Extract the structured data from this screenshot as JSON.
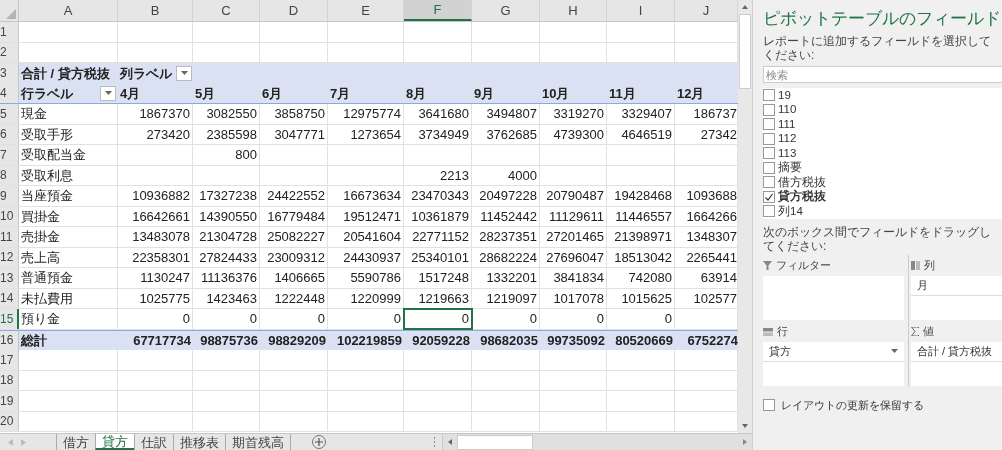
{
  "columns": [
    {
      "label": "A",
      "selected": false
    },
    {
      "label": "B",
      "selected": false
    },
    {
      "label": "C",
      "selected": false
    },
    {
      "label": "D",
      "selected": false
    },
    {
      "label": "E",
      "selected": false
    },
    {
      "label": "F",
      "selected": true
    },
    {
      "label": "G",
      "selected": false
    },
    {
      "label": "H",
      "selected": false
    },
    {
      "label": "I",
      "selected": false
    },
    {
      "label": "J",
      "selected": false
    }
  ],
  "rows": [
    {
      "number": "1",
      "selected": false,
      "kind": "empty"
    },
    {
      "number": "2",
      "selected": false,
      "kind": "empty"
    },
    {
      "number": "3",
      "selected": false,
      "kind": "pivot_header",
      "value_field": "合計 / 貸方税抜",
      "column_label": "列ラベル"
    },
    {
      "number": "4",
      "selected": false,
      "kind": "column_labels",
      "row_label": "行ラベル",
      "months": [
        "4月",
        "5月",
        "6月",
        "7月",
        "8月",
        "9月",
        "10月",
        "11月",
        "12月"
      ]
    },
    {
      "number": "5",
      "selected": false,
      "kind": "data",
      "label": "現金",
      "values": [
        "1867370",
        "3082550",
        "3858750",
        "12975774",
        "3641680",
        "3494807",
        "3319270",
        "3329407",
        "186737"
      ]
    },
    {
      "number": "6",
      "selected": false,
      "kind": "data",
      "label": "受取手形",
      "values": [
        "273420",
        "2385598",
        "3047771",
        "1273654",
        "3734949",
        "3762685",
        "4739300",
        "4646519",
        "27342"
      ]
    },
    {
      "number": "7",
      "selected": false,
      "kind": "data",
      "label": "受取配当金",
      "values": [
        {
          "kind": "blank"
        },
        "800",
        {
          "kind": "blank"
        },
        {
          "kind": "blank"
        },
        {
          "kind": "blank"
        },
        {
          "kind": "blank"
        },
        {
          "kind": "blank"
        },
        {
          "kind": "blank"
        },
        {
          "kind": "blank"
        }
      ]
    },
    {
      "number": "8",
      "selected": false,
      "kind": "data",
      "label": "受取利息",
      "values": [
        {
          "kind": "blank"
        },
        {
          "kind": "blank"
        },
        {
          "kind": "blank"
        },
        {
          "kind": "blank"
        },
        "2213",
        "4000",
        {
          "kind": "blank"
        },
        {
          "kind": "blank"
        },
        {
          "kind": "blank"
        }
      ]
    },
    {
      "number": "9",
      "selected": false,
      "kind": "data",
      "label": "当座預金",
      "values": [
        "10936882",
        "17327238",
        "24422552",
        "16673634",
        "23470343",
        "20497228",
        "20790487",
        "19428468",
        "1093688"
      ]
    },
    {
      "number": "10",
      "selected": false,
      "kind": "data",
      "label": "買掛金",
      "values": [
        "16642661",
        "14390550",
        "16779484",
        "19512471",
        "10361879",
        "11452442",
        "11129611",
        "11446557",
        "1664266"
      ]
    },
    {
      "number": "11",
      "selected": false,
      "kind": "data",
      "label": "売掛金",
      "values": [
        "13483078",
        "21304728",
        "25082227",
        "20541604",
        "22771152",
        "28237351",
        "27201465",
        "21398971",
        "1348307"
      ]
    },
    {
      "number": "12",
      "selected": false,
      "kind": "data",
      "label": "売上高",
      "values": [
        "22358301",
        "27824433",
        "23009312",
        "24430937",
        "25340101",
        "28682224",
        "27696047",
        "18513042",
        "2265441"
      ]
    },
    {
      "number": "13",
      "selected": false,
      "kind": "data",
      "label": "普通預金",
      "values": [
        "1130247",
        "11136376",
        "1406665",
        "5590786",
        "1517248",
        "1332201",
        "3841834",
        "742080",
        "63914"
      ]
    },
    {
      "number": "14",
      "selected": false,
      "kind": "data",
      "label": "未払費用",
      "values": [
        "1025775",
        "1423463",
        "1222448",
        "1220999",
        "1219663",
        "1219097",
        "1017078",
        "1015625",
        "102577"
      ]
    },
    {
      "number": "15",
      "selected": true,
      "kind": "data",
      "label": "預り金",
      "values": [
        "0",
        "0",
        "0",
        "0",
        "0",
        "0",
        "0",
        "0",
        {
          "kind": "blank"
        }
      ]
    },
    {
      "number": "16",
      "selected": false,
      "kind": "total",
      "label": "総計",
      "values": [
        "67717734",
        "98875736",
        "98829209",
        "102219859",
        "92059228",
        "98682035",
        "99735092",
        "80520669",
        "6752274"
      ]
    },
    {
      "number": "17",
      "selected": false,
      "kind": "empty"
    },
    {
      "number": "18",
      "selected": false,
      "kind": "empty"
    },
    {
      "number": "19",
      "selected": false,
      "kind": "empty"
    },
    {
      "number": "20",
      "selected": false,
      "kind": "empty"
    }
  ],
  "sheet_tabs": [
    {
      "label": "借方",
      "selected": false
    },
    {
      "label": "貸方",
      "selected": true
    },
    {
      "label": "仕訳",
      "selected": false
    },
    {
      "label": "推移表",
      "selected": false
    },
    {
      "label": "期首残高",
      "selected": false
    }
  ],
  "pivot_panel": {
    "title": "ピボットテーブルのフィールド",
    "subtitle": "レポートに追加するフィールドを選択してください:",
    "search": {
      "placeholder": "検索"
    },
    "fields": [
      {
        "label": "19",
        "checked": false
      },
      {
        "label": "110",
        "checked": false
      },
      {
        "label": "111",
        "checked": false
      },
      {
        "label": "112",
        "checked": false
      },
      {
        "label": "113",
        "checked": false
      },
      {
        "label": "摘要",
        "checked": false
      },
      {
        "label": "借方税抜",
        "checked": false
      },
      {
        "label": "貸方税抜",
        "checked": true
      },
      {
        "label": "列14",
        "checked": false
      }
    ],
    "drag_hint": "次のボックス間でフィールドをドラッグしてください:",
    "areas": [
      {
        "kind": "filter",
        "title": "フィルター"
      },
      {
        "kind": "columns",
        "title": "列",
        "items": [
          {
            "label": "月"
          }
        ]
      },
      {
        "kind": "rows",
        "title": "行",
        "items": [
          {
            "label": "貸方",
            "dropdown": true
          }
        ]
      },
      {
        "kind": "values",
        "title": "値",
        "items": [
          {
            "label": "合計 / 貸方税抜"
          }
        ]
      }
    ],
    "defer_update": {
      "label": "レイアウトの更新を保留する",
      "checked": false
    }
  }
}
